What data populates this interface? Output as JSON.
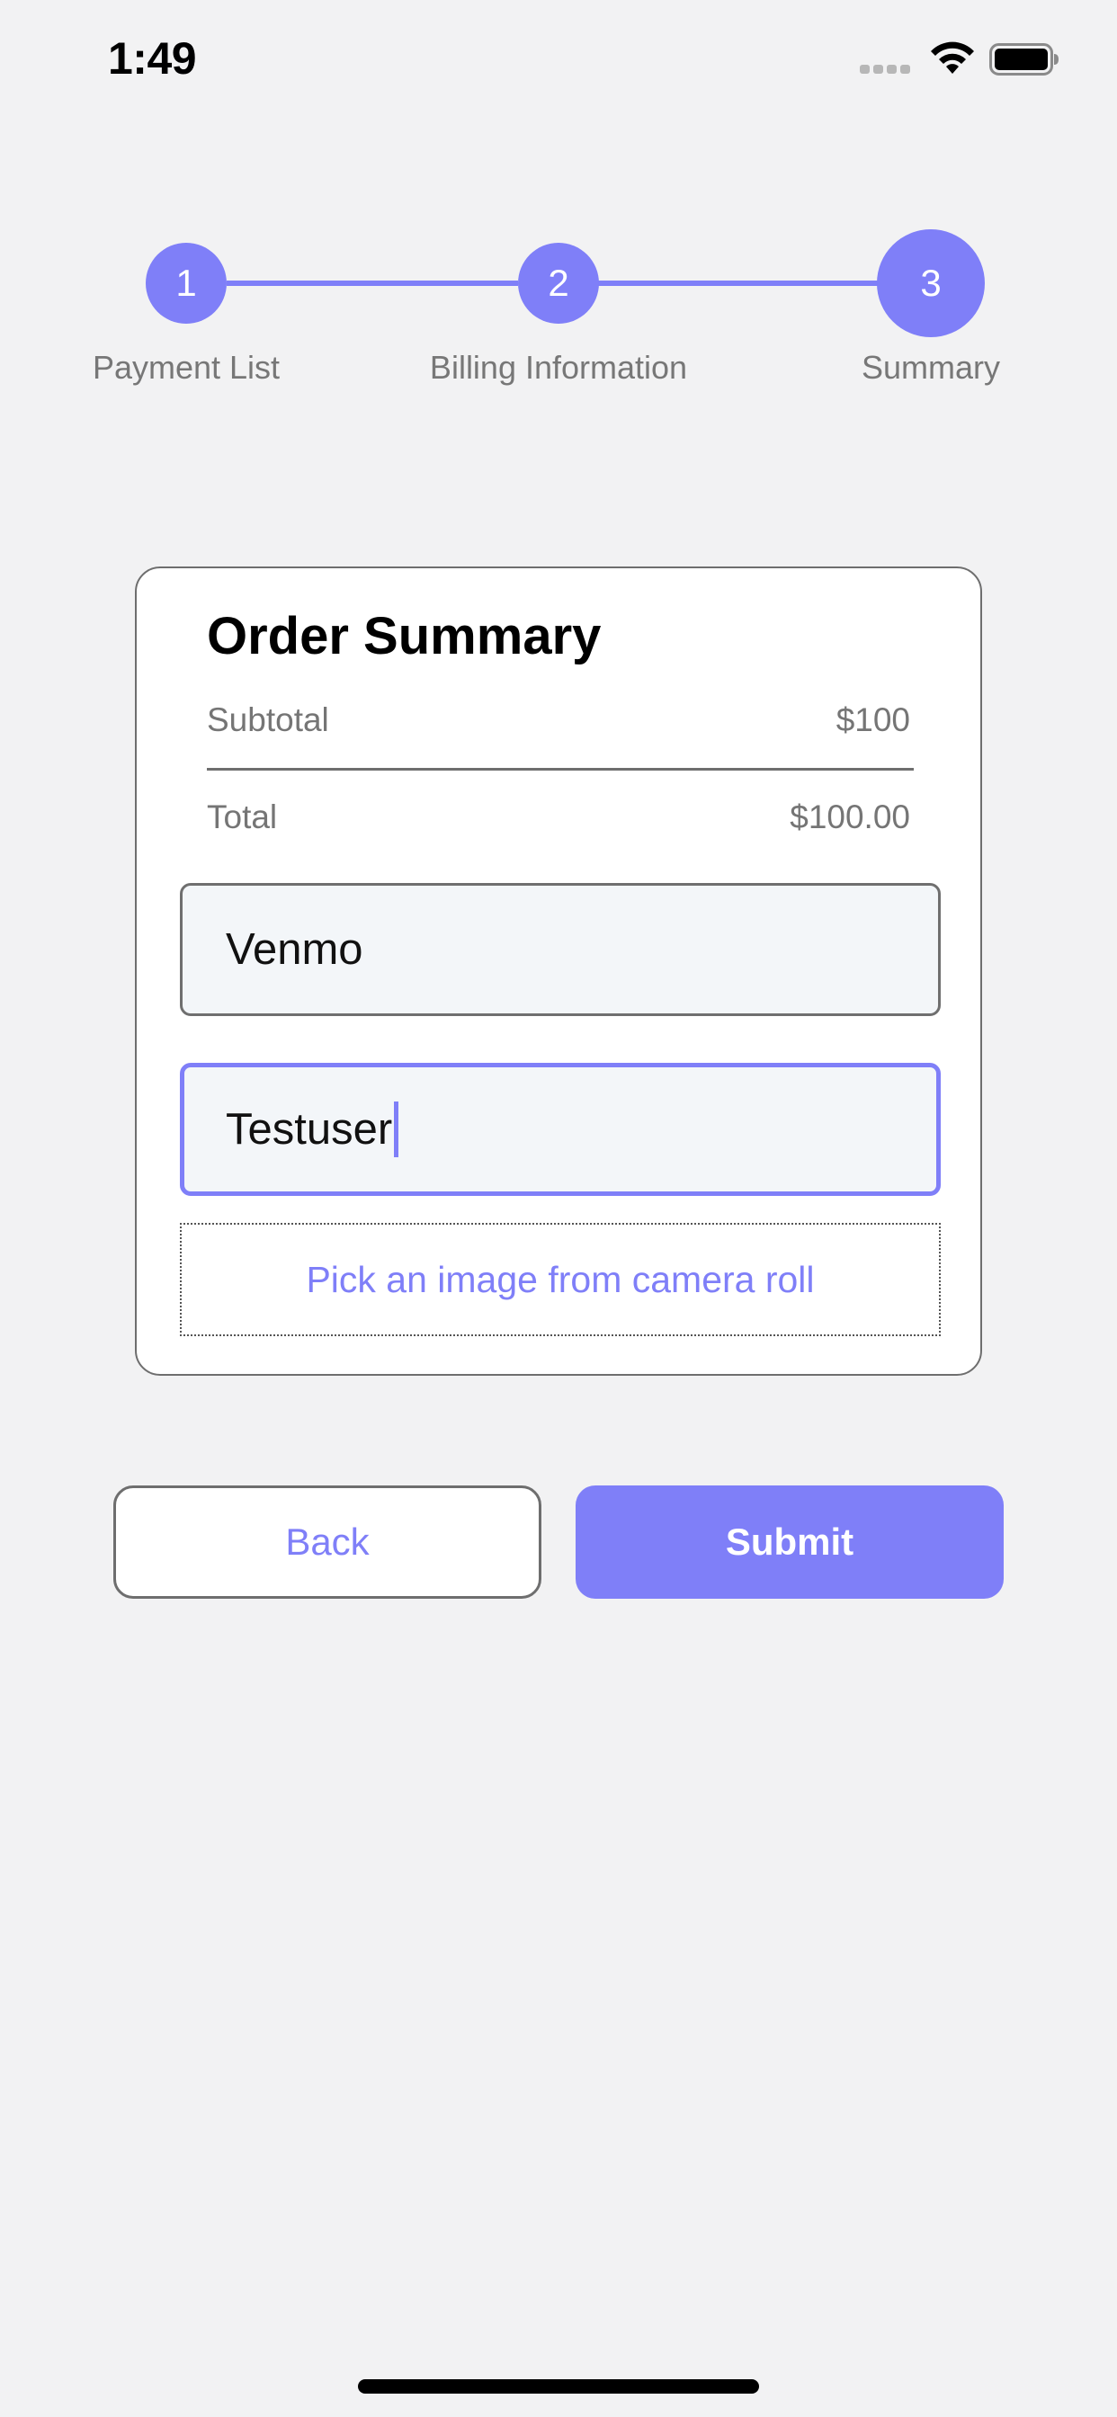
{
  "status_bar": {
    "time": "1:49",
    "icons": [
      "signal-dots-icon",
      "wifi-icon",
      "battery-icon"
    ]
  },
  "stepper": {
    "steps": [
      {
        "number": "1",
        "label": "Payment List"
      },
      {
        "number": "2",
        "label": "Billing Information"
      },
      {
        "number": "3",
        "label": "Summary"
      }
    ],
    "active_step": 3
  },
  "order_summary": {
    "title": "Order Summary",
    "subtotal_label": "Subtotal",
    "subtotal_value": "$100",
    "total_label": "Total",
    "total_value": "$100.00",
    "payment_method_value": "Venmo",
    "username_value": "Testuser",
    "pick_image_label": "Pick an image from camera roll"
  },
  "actions": {
    "back_label": "Back",
    "submit_label": "Submit"
  },
  "colors": {
    "accent": "#7f7ff8",
    "background": "#f2f2f3",
    "card": "#ffffff",
    "muted_text": "#777777"
  }
}
